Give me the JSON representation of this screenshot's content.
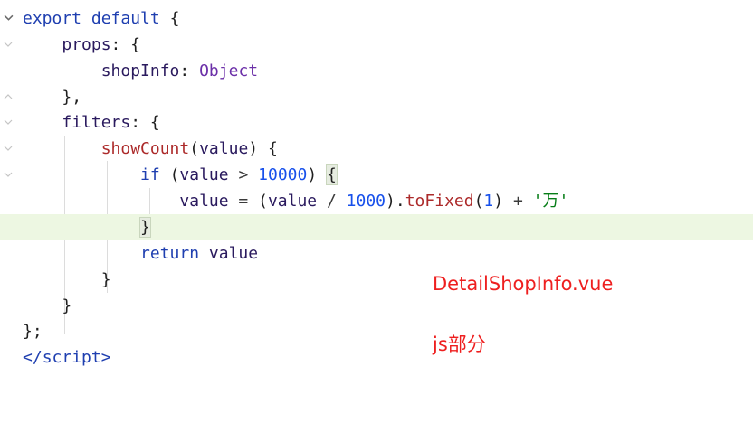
{
  "code": {
    "l1": {
      "kw1": "export",
      "kw2": "default",
      "brace": "{"
    },
    "l2": {
      "key": "props",
      "colon": ":",
      "brace": "{"
    },
    "l3": {
      "key": "shopInfo",
      "colon": ":",
      "type": "Object"
    },
    "l4": {
      "text": "},"
    },
    "l5": {
      "key": "filters",
      "colon": ":",
      "brace": "{"
    },
    "l6": {
      "fn": "showCount",
      "open": "(",
      "param": "value",
      "close": ")",
      "brace": "{"
    },
    "l7": {
      "kw": "if",
      "open": "(",
      "var": "value",
      "op": ">",
      "num": "10000",
      "close": ")",
      "brace": "{"
    },
    "l8": {
      "var": "value",
      "eq": "=",
      "open": "(",
      "var2": "value",
      "div": "/",
      "num": "1000",
      "close": ").",
      "method": "toFixed",
      "p1": "(",
      "arg": "1",
      "p2": ")",
      "plus": "+",
      "str": "'万'"
    },
    "l9": {
      "brace": "}"
    },
    "l10": {
      "kw": "return",
      "var": "value"
    },
    "l11": {
      "brace": "}"
    },
    "l12": {
      "brace": "}"
    },
    "l13": {
      "text": "};"
    },
    "l14": {
      "open": "</",
      "tag": "script",
      "close": ">"
    }
  },
  "annotations": {
    "filename": "DetailShopInfo.vue",
    "section": "js部分"
  },
  "colors": {
    "keyword": "#1f3fb0",
    "function": "#ac2a2a",
    "number": "#1750eb",
    "string": "#067d17",
    "type": "#6b2fa8",
    "annotation": "#ee1f1f",
    "highlight_line": "#edf7e2"
  }
}
